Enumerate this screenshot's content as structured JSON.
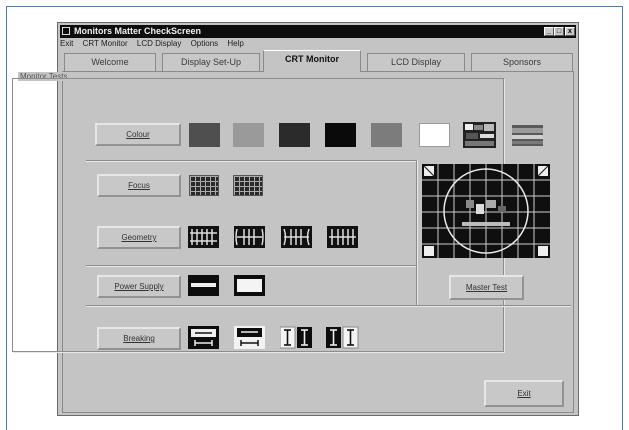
{
  "window": {
    "title": "Monitors Matter CheckScreen",
    "minimize": "_",
    "maximize": "□",
    "close": "x"
  },
  "menu": [
    "Exit",
    "CRT Monitor",
    "LCD Display",
    "Options",
    "Help"
  ],
  "tabs": [
    {
      "label": "Welcome",
      "active": false
    },
    {
      "label": "Display Set-Up",
      "active": false
    },
    {
      "label": "CRT Monitor",
      "active": true
    },
    {
      "label": "LCD Display",
      "active": false
    },
    {
      "label": "Sponsors",
      "active": false
    }
  ],
  "group_label": "Monitor Tests",
  "buttons": {
    "colour": "Colour",
    "focus": "Focus",
    "geometry": "Geometry",
    "power_supply": "Power Supply",
    "master_test": "Master Test",
    "breaking": "Breaking",
    "exit": "Exit"
  },
  "colour_swatches": [
    "#4f4f4f",
    "#9a9a9a",
    "#2b2b2b",
    "#0a0a0a",
    "#7c7c7c",
    "#ffffff"
  ],
  "icons": {
    "colour_tests": [
      "grey-swatch-icon",
      "grey-swatch-icon",
      "grey-swatch-icon",
      "black-swatch-icon",
      "grey-swatch-icon",
      "white-swatch-icon",
      "colour-bars-icon",
      "colour-gradient-icon"
    ],
    "focus_tests": [
      "focus-grid-icon",
      "focus-grid-icon"
    ],
    "geometry_tests": [
      "geometry-pattern-icon",
      "geometry-pattern-icon",
      "geometry-pattern-icon",
      "geometry-pattern-icon"
    ],
    "power_supply_tests": [
      "power-supply-black-icon",
      "power-supply-white-icon"
    ],
    "breaking_tests": [
      "breaking-black-icon",
      "breaking-white-icon",
      "breaking-bar-icon",
      "breaking-bar-icon"
    ],
    "preview": "master-test-pattern-icon"
  }
}
